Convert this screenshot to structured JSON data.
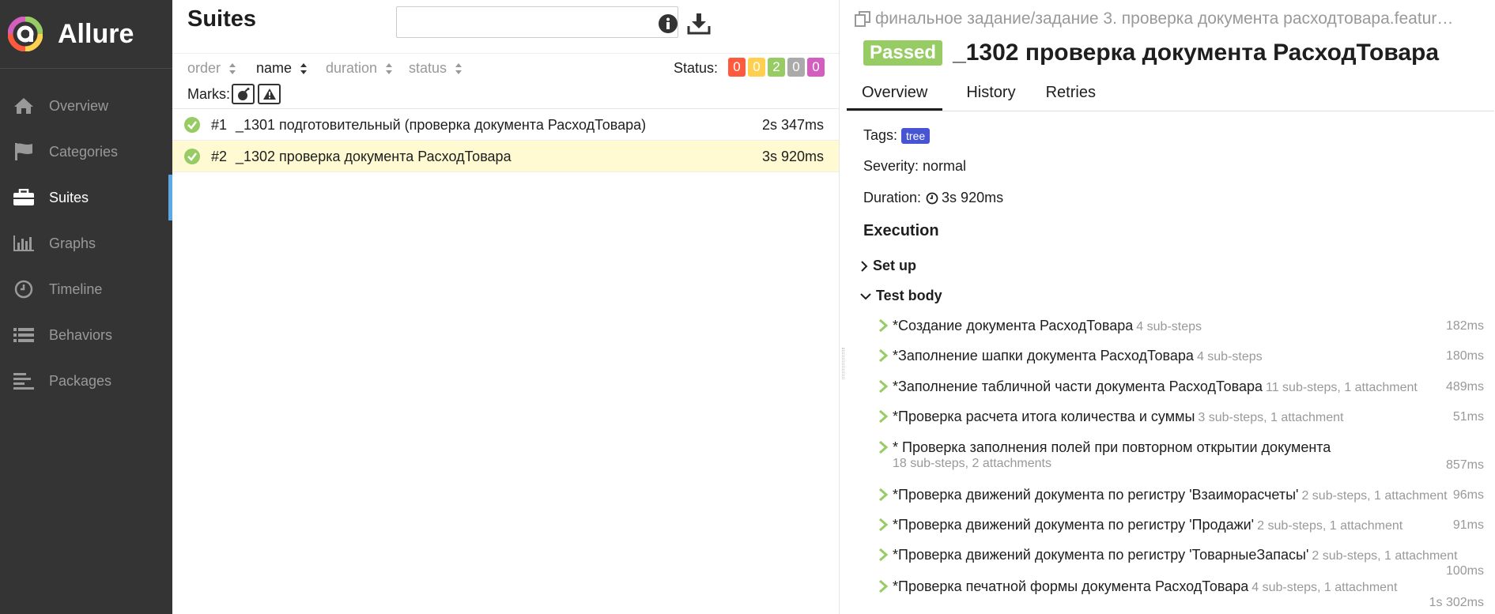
{
  "brand": {
    "name": "Allure"
  },
  "sidebar": {
    "items": [
      {
        "label": "Overview",
        "icon": "home-icon",
        "active": false
      },
      {
        "label": "Categories",
        "icon": "flag-icon",
        "active": false
      },
      {
        "label": "Suites",
        "icon": "briefcase-icon",
        "active": true
      },
      {
        "label": "Graphs",
        "icon": "bar-chart-icon",
        "active": false
      },
      {
        "label": "Timeline",
        "icon": "clock-icon",
        "active": false
      },
      {
        "label": "Behaviors",
        "icon": "list-icon",
        "active": false
      },
      {
        "label": "Packages",
        "icon": "align-left-icon",
        "active": false
      }
    ]
  },
  "suites": {
    "title": "Suites",
    "search": {
      "value": "",
      "placeholder": ""
    },
    "sort": {
      "order": "order",
      "name": "name",
      "duration": "duration",
      "status": "status"
    },
    "status_label": "Status:",
    "status_counts": [
      {
        "value": "0",
        "color": "#fd5a3e",
        "name": "failed"
      },
      {
        "value": "0",
        "color": "#ffd050",
        "name": "broken"
      },
      {
        "value": "2",
        "color": "#97cc64",
        "name": "passed"
      },
      {
        "value": "0",
        "color": "#aaaaaa",
        "name": "skipped"
      },
      {
        "value": "0",
        "color": "#d35ebe",
        "name": "unknown"
      }
    ],
    "marks_label": "Marks:",
    "rows": [
      {
        "index": "#1",
        "name": "_1301 подготовительный (проверка документа РасходТовара)",
        "duration": "2s 347ms",
        "selected": false
      },
      {
        "index": "#2",
        "name": "_1302 проверка документа РасходТовара",
        "duration": "3s 920ms",
        "selected": true
      }
    ]
  },
  "detail": {
    "path": "финальное задание/задание 3. проверка документа расходтовара.featur…",
    "status": "Passed",
    "title": "_1302 проверка документа РасходТовара",
    "tabs": [
      "Overview",
      "History",
      "Retries"
    ],
    "tags_label": "Tags:",
    "tag": "tree",
    "severity": "Severity: normal",
    "duration_label": "Duration:",
    "duration": "3s 920ms",
    "execution_title": "Execution",
    "setup_label": "Set up",
    "body_label": "Test body",
    "steps": [
      {
        "name": "*Создание документа РасходТовара",
        "sub": "4 sub-steps",
        "duration": "182ms"
      },
      {
        "name": "*Заполнение шапки документа РасходТовара",
        "sub": "4 sub-steps",
        "duration": "180ms"
      },
      {
        "name": "*Заполнение табличной части документа РасходТовара",
        "sub": "11 sub-steps, 1 attachment",
        "duration": "489ms"
      },
      {
        "name": "*Проверка расчета итога количества и суммы",
        "sub": "3 sub-steps, 1 attachment",
        "duration": "51ms"
      },
      {
        "name": "* Проверка заполнения полей при повторном открытии документа",
        "sub": "18 sub-steps, 2 attachments",
        "duration": "857ms"
      },
      {
        "name": "*Проверка движений документа по регистру 'Взаиморасчеты'",
        "sub": "2 sub-steps, 1 attachment",
        "duration": "96ms"
      },
      {
        "name": "*Проверка движений документа по регистру 'Продажи'",
        "sub": "2 sub-steps, 1 attachment",
        "duration": "91ms"
      },
      {
        "name": "*Проверка движений документа по регистру 'ТоварныеЗапасы'",
        "sub": "2 sub-steps, 1 attachment",
        "duration": "100ms"
      },
      {
        "name": "*Проверка печатной формы документа РасходТовара",
        "sub": "4 sub-steps, 1 attachment",
        "duration": "1s 302ms"
      }
    ]
  }
}
